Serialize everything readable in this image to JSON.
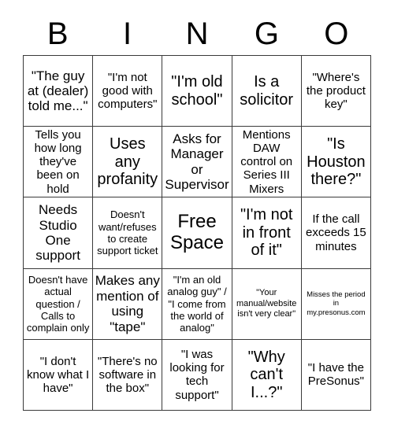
{
  "card": {
    "title_letters": [
      "B",
      "I",
      "N",
      "G",
      "O"
    ],
    "columns": 5,
    "rows": 5,
    "border_color": "#3a3a3a",
    "background_color": "#ffffff",
    "text_color": "#000000",
    "cells": [
      {
        "text": "\"The guy at (dealer) told me...\"",
        "size": "lg"
      },
      {
        "text": "\"I'm not good with computers\"",
        "size": "md"
      },
      {
        "text": "\"I'm old school\"",
        "size": "xl"
      },
      {
        "text": "Is a solicitor",
        "size": "xl"
      },
      {
        "text": "\"Where's the product key\"",
        "size": "md"
      },
      {
        "text": "Tells you how long they've been on hold",
        "size": "md"
      },
      {
        "text": "Uses any profanity",
        "size": "xl"
      },
      {
        "text": "Asks for Manager or Supervisor",
        "size": "lg"
      },
      {
        "text": "Mentions DAW control on Series III Mixers",
        "size": "md"
      },
      {
        "text": "\"Is Houston there?\"",
        "size": "xl"
      },
      {
        "text": "Needs Studio One support",
        "size": "lg"
      },
      {
        "text": "Doesn't want/refuses to create support ticket",
        "size": "sm"
      },
      {
        "text": "Free Space",
        "size": "xxl"
      },
      {
        "text": "\"I'm not in front of it\"",
        "size": "xl"
      },
      {
        "text": "If the call exceeds 15 minutes",
        "size": "md"
      },
      {
        "text": "Doesn't have actual question / Calls to complain only",
        "size": "sm"
      },
      {
        "text": "Makes any mention of using \"tape\"",
        "size": "lg"
      },
      {
        "text": "\"I'm an old analog guy\" / \"I come from the world of analog\"",
        "size": "sm"
      },
      {
        "text": "\"Your manual/website isn't very clear\"",
        "size": "xs"
      },
      {
        "text": "Misses the period in my.presonus.com",
        "size": "xxs"
      },
      {
        "text": "\"I don't know what I have\"",
        "size": "md"
      },
      {
        "text": "\"There's no software in the box\"",
        "size": "md"
      },
      {
        "text": "\"I was looking for tech support\"",
        "size": "md"
      },
      {
        "text": "\"Why can't I...?\"",
        "size": "xl"
      },
      {
        "text": "\"I have the PreSonus\"",
        "size": "md"
      }
    ]
  }
}
